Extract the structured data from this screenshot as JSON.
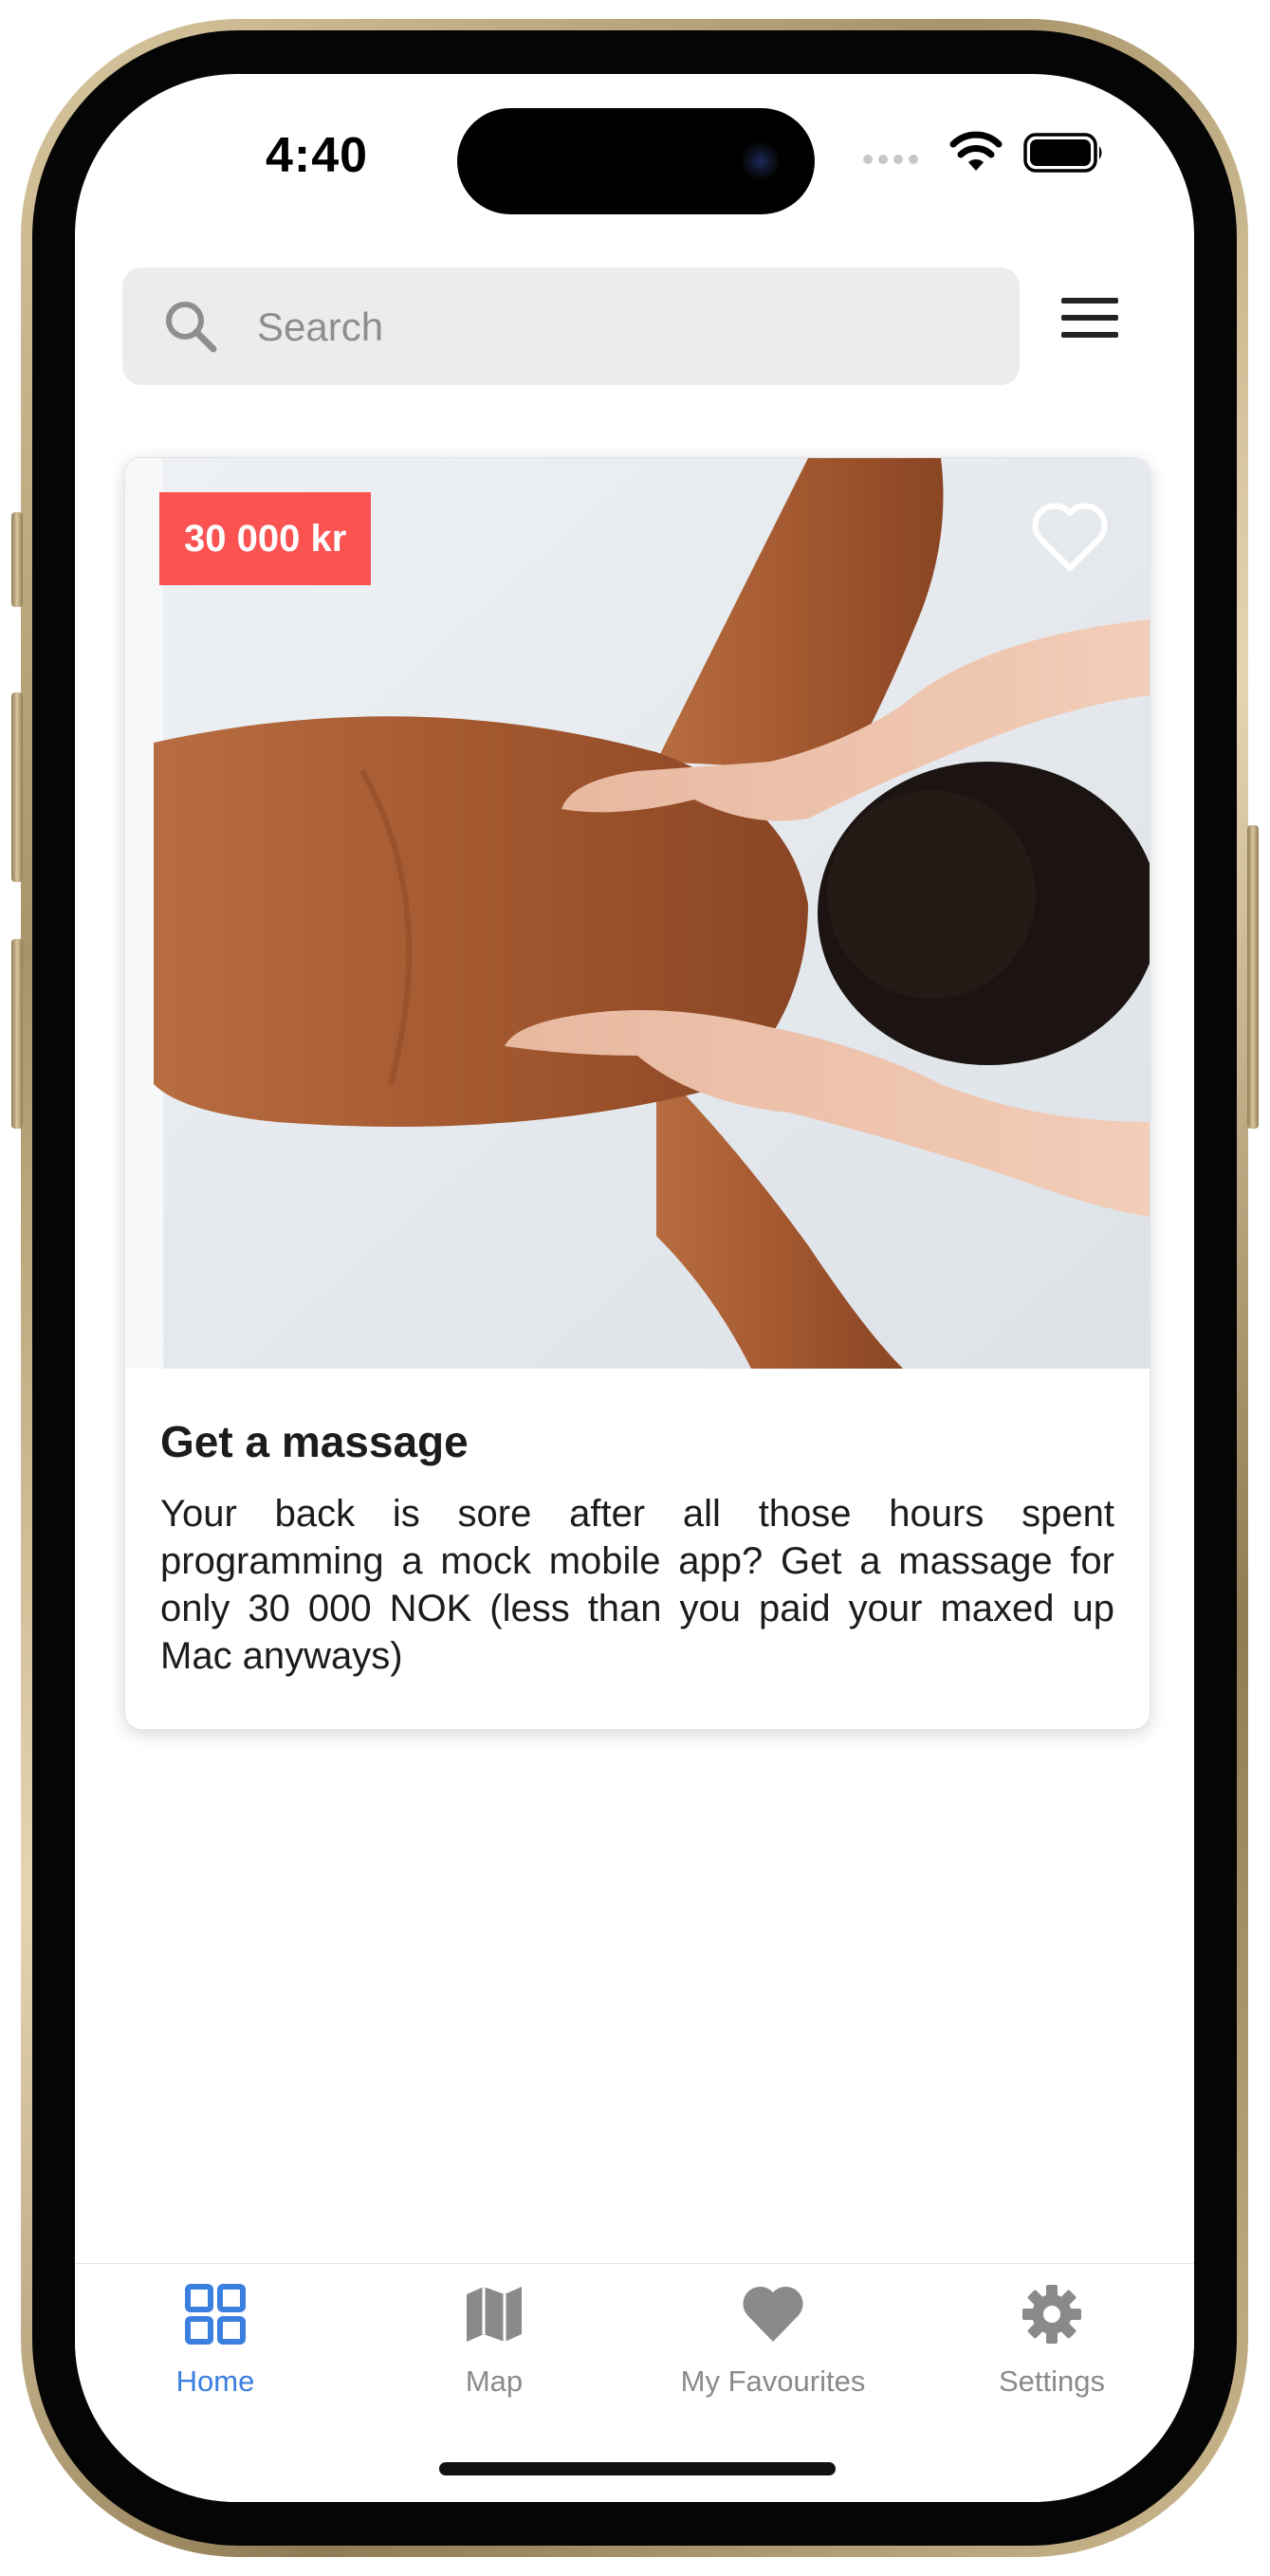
{
  "status_bar": {
    "time": "4:40",
    "icons": [
      "signal-icon",
      "wifi-icon",
      "battery-icon"
    ]
  },
  "search": {
    "placeholder": "Search",
    "value": ""
  },
  "header": {
    "menu_icon": "hamburger-menu-icon"
  },
  "card": {
    "price": "30 000 kr",
    "title": "Get a massage",
    "description": "Your back is sore after all those hours spent programming a mock mobile app? Get a massage for only 30 000 NOK (less than you paid your maxed up Mac anyways)",
    "image": "massage-photo",
    "favourite_icon": "heart-outline-icon"
  },
  "tabbar": {
    "tabs": [
      {
        "label": "Home",
        "icon": "grid-icon",
        "active": true
      },
      {
        "label": "Map",
        "icon": "map-icon",
        "active": false
      },
      {
        "label": "My Favourites",
        "icon": "heart-icon",
        "active": false
      },
      {
        "label": "Settings",
        "icon": "gear-icon",
        "active": false
      }
    ]
  },
  "colors": {
    "accent": "#3b7fe0",
    "badge": "#fb5252",
    "inactive": "#8a8a8a",
    "search_bg": "#ececec"
  }
}
